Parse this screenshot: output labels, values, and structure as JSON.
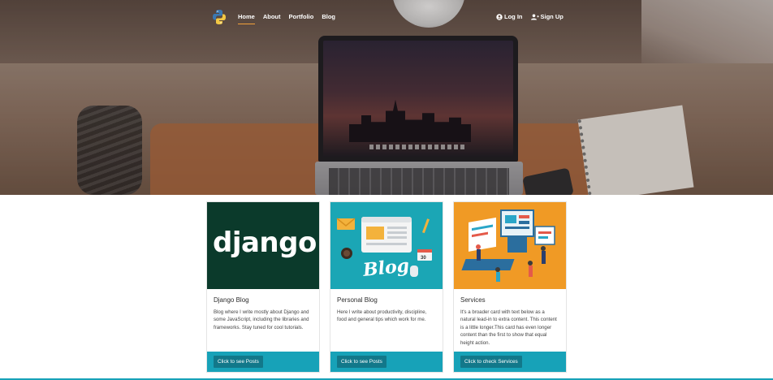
{
  "nav": {
    "links": [
      {
        "label": "Home",
        "active": true
      },
      {
        "label": "About"
      },
      {
        "label": "Portfolio"
      },
      {
        "label": "Blog"
      }
    ],
    "login_label": "Log In",
    "signup_label": "Sign Up"
  },
  "cards": [
    {
      "image_text": "django",
      "title": "Django Blog",
      "text": "Blog where I write mostly about Django and some JavaScript, including the libraries and frameworks. Stay tuned for cool tutorials.",
      "button": "Click to see Posts"
    },
    {
      "image_text": "Blog",
      "title": "Personal Blog",
      "text": "Here I write about productivity, discipline, food and general tips which work for me.",
      "button": "Click to see Posts",
      "calendar_number": "30"
    },
    {
      "title": "Services",
      "text": "It's a broader card with text below as a natural lead-in to extra content. This content is a little longer.This card has even longer content than the first to show that equal height action.",
      "button": "Click to check Services"
    }
  ],
  "colors": {
    "accent": "#17a2b8",
    "button": "#12788a",
    "nav_underline": "#f2a23a",
    "django_bg": "#0b3a2b",
    "blog_bg": "#1ba6b5",
    "services_bg": "#f09a25"
  }
}
